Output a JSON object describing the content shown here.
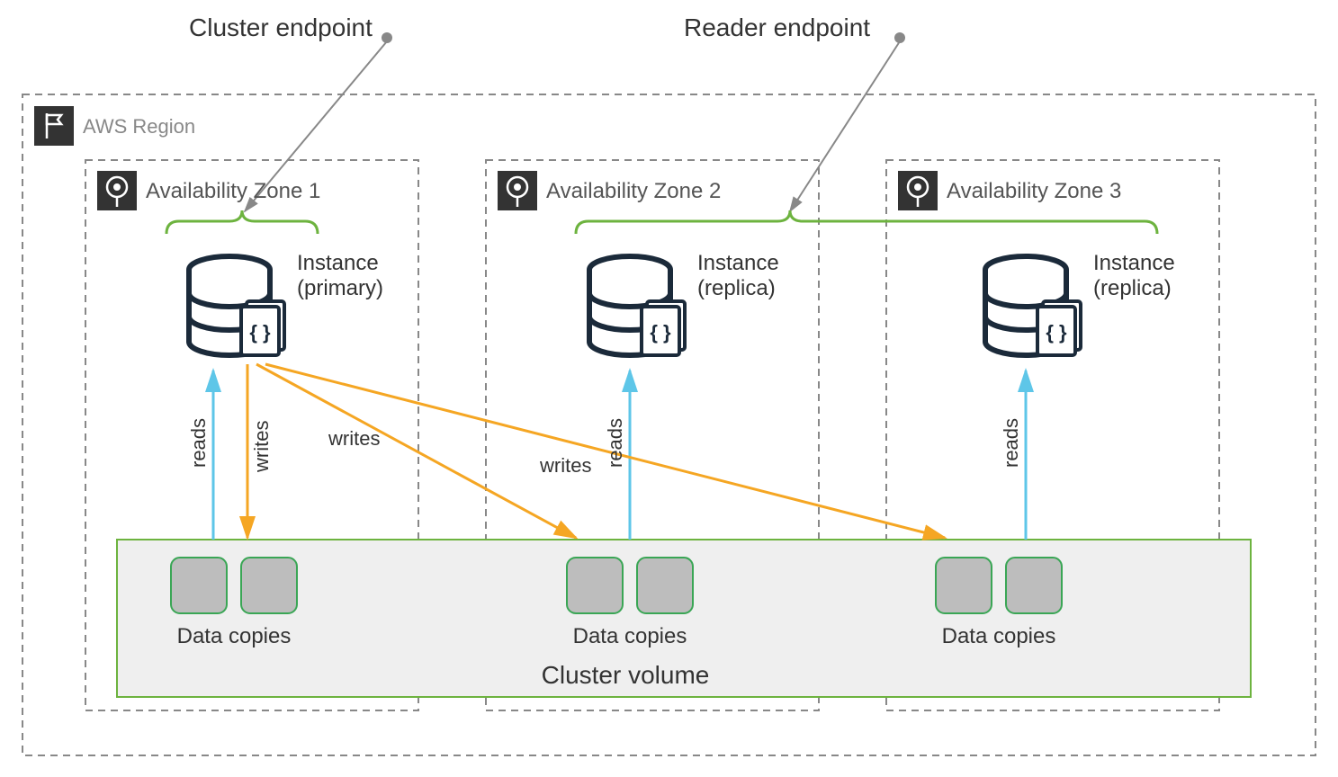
{
  "labels": {
    "cluster_endpoint": "Cluster endpoint",
    "reader_endpoint": "Reader endpoint",
    "region": "AWS Region",
    "az1": "Availability Zone 1",
    "az2": "Availability Zone 2",
    "az3": "Availability Zone 3",
    "instance": "Instance",
    "primary": "(primary)",
    "replica": "(replica)",
    "reads": "reads",
    "writes": "writes",
    "data_copies": "Data copies",
    "cluster_volume": "Cluster volume"
  },
  "colors": {
    "dash": "#888888",
    "green": "#6db33f",
    "blue": "#5ec6e8",
    "orange": "#f5a623",
    "iconbg": "#333333",
    "grey": "#bdbdbd",
    "lightgrey": "#efefef",
    "dbstroke": "#1b2a3a"
  }
}
